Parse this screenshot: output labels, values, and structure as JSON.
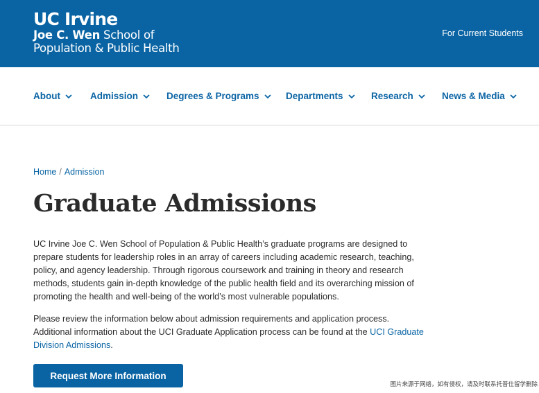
{
  "header": {
    "logo_uc": "UC Irvine",
    "logo_line1_bold": "Joe C. Wen",
    "logo_line1_rest": " School of",
    "logo_line2": "Population & Public Health",
    "utility_link": "For Current Students"
  },
  "nav": {
    "items": [
      {
        "label": "About"
      },
      {
        "label": "Admission"
      },
      {
        "label": "Degrees & Programs"
      },
      {
        "label": "Departments"
      },
      {
        "label": "Research"
      },
      {
        "label": "News & Media"
      }
    ],
    "chevron_icon": "chevron-down-icon"
  },
  "breadcrumb": {
    "home": "Home",
    "separator": "/",
    "current": "Admission"
  },
  "page": {
    "title": "Graduate Admissions",
    "paragraph1": "UC Irvine Joe C. Wen School of Population & Public Health’s graduate programs are designed to prepare students for leadership roles in an array of careers including academic research, teaching, policy, and agency leadership. Through rigorous coursework and training in theory and research methods, students gain in-depth knowledge of the public health field and its overarching mission of promoting the health and well-being of the world’s most vulnerable populations.",
    "paragraph2_text": "Please review the information below about admission requirements and application process. Additional information about the UCI Graduate Application process can be found at the ",
    "paragraph2_link": "UCI Graduate Division Admissions",
    "paragraph2_end": ".",
    "cta_label": "Request More Information"
  },
  "watermark": "图片来源于网络，如有侵权，请及时联系托普仕留学删除",
  "colors": {
    "brand_blue": "#0a64a4",
    "text": "#2b2b2b",
    "white": "#ffffff"
  }
}
